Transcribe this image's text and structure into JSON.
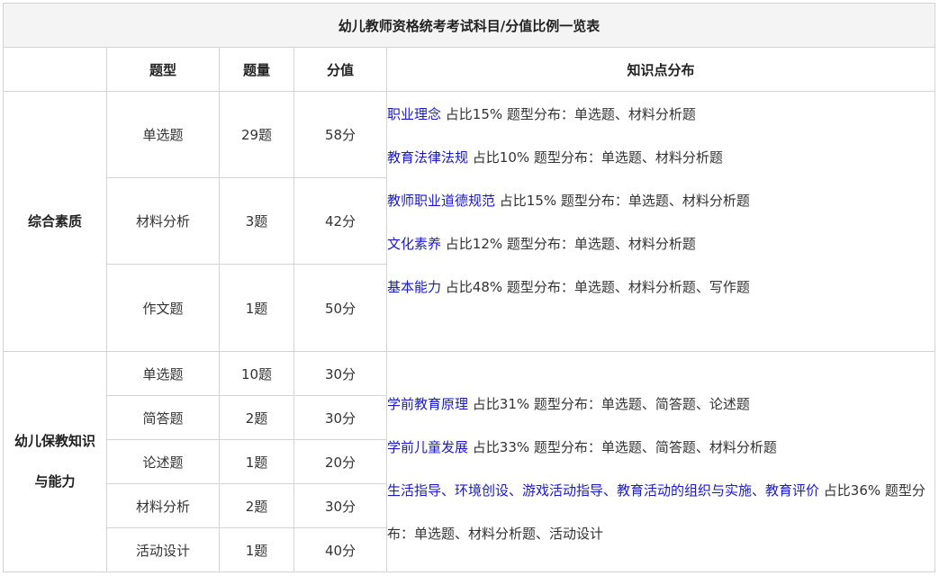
{
  "title": "幼儿教师资格统考考试科目/分值比例一览表",
  "headers": [
    "",
    "题型",
    "题量",
    "分值",
    "知识点分布"
  ],
  "sections": [
    {
      "subject": "综合素质",
      "rows": [
        {
          "type": "单选题",
          "count": "29题",
          "score": "58分"
        },
        {
          "type": "材料分析",
          "count": "3题",
          "score": "42分"
        },
        {
          "type": "作文题",
          "count": "1题",
          "score": "50分"
        }
      ],
      "knowledge": [
        {
          "link": "职业理念",
          "text": " 占比15% 题型分布：单选题、材料分析题"
        },
        {
          "link": "教育法律法规",
          "text": " 占比10% 题型分布：单选题、材料分析题"
        },
        {
          "link": "教师职业道德规范",
          "text": " 占比15% 题型分布：单选题、材料分析题"
        },
        {
          "link": "文化素养",
          "text": " 占比12% 题型分布：单选题、材料分析题"
        },
        {
          "link": "基本能力",
          "text": " 占比48% 题型分布：单选题、材料分析题、写作题"
        }
      ]
    },
    {
      "subject_line1": "幼儿保教知识",
      "subject_line2": "与能力",
      "rows": [
        {
          "type": "单选题",
          "count": "10题",
          "score": "30分"
        },
        {
          "type": "简答题",
          "count": "2题",
          "score": "30分"
        },
        {
          "type": "论述题",
          "count": "1题",
          "score": "20分"
        },
        {
          "type": "材料分析",
          "count": "2题",
          "score": "30分"
        },
        {
          "type": "活动设计",
          "count": "1题",
          "score": "40分"
        }
      ],
      "knowledge": [
        {
          "link": "学前教育原理",
          "text": " 占比31% 题型分布：单选题、简答题、论述题"
        },
        {
          "link": "学前儿童发展",
          "text": " 占比33% 题型分布：单选题、简答题、材料分析题"
        },
        {
          "link": "生活指导、环境创设、游戏活动指导、教育活动的组织与实施、教育评价",
          "text": " 占比36% 题型分布：单选题、材料分析题、活动设计"
        }
      ]
    }
  ],
  "colors": {
    "link": "#1a1acc",
    "border": "#d4d4d4",
    "title_bg": "#f4f4f4"
  }
}
